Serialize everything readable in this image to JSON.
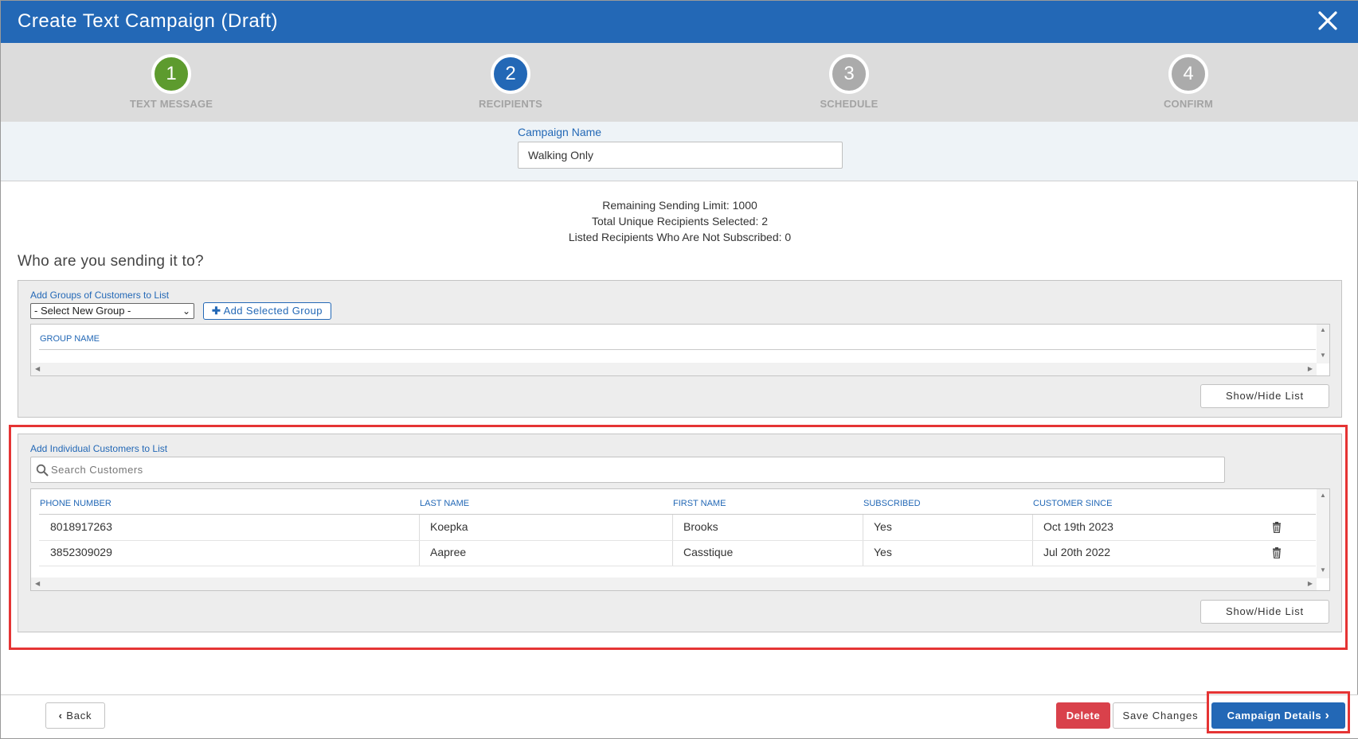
{
  "header": {
    "title": "Create Text Campaign (Draft)"
  },
  "steps": [
    {
      "number": "1",
      "label": "TEXT MESSAGE",
      "color": "#5d9b2e"
    },
    {
      "number": "2",
      "label": "RECIPIENTS",
      "color": "#2368b6"
    },
    {
      "number": "3",
      "label": "SCHEDULE",
      "color": "#ababab"
    },
    {
      "number": "4",
      "label": "CONFIRM",
      "color": "#ababab"
    }
  ],
  "campaign": {
    "name_label": "Campaign Name",
    "name_value": "Walking Only"
  },
  "stats": {
    "remaining": "Remaining Sending Limit: 1000",
    "total": "Total Unique Recipients Selected: 2",
    "not_subscribed": "Listed Recipients Who Are Not Subscribed: 0"
  },
  "section_question": "Who are you sending it to?",
  "groups": {
    "label": "Add Groups of Customers to List",
    "select_value": "- Select New Group -",
    "add_button": "Add Selected Group",
    "column": "GROUP NAME",
    "toggle_button": "Show/Hide List"
  },
  "individuals": {
    "label": "Add Individual Customers to List",
    "search_placeholder": "Search Customers",
    "columns": [
      "PHONE NUMBER",
      "LAST NAME",
      "FIRST NAME",
      "SUBSCRIBED",
      "CUSTOMER SINCE"
    ],
    "rows": [
      {
        "phone": "8018917263",
        "last": "Koepka",
        "first": "Brooks",
        "subscribed": "Yes",
        "since": "Oct 19th 2023"
      },
      {
        "phone": "3852309029",
        "last": "Aapree",
        "first": "Casstique",
        "subscribed": "Yes",
        "since": "Jul 20th 2022"
      }
    ],
    "toggle_button": "Show/Hide List"
  },
  "footer": {
    "back": "Back",
    "delete": "Delete",
    "save": "Save Changes",
    "next": "Campaign Details"
  },
  "colors": {
    "brand": "#2368b6",
    "danger": "#d9414b",
    "highlight": "#e53434"
  }
}
